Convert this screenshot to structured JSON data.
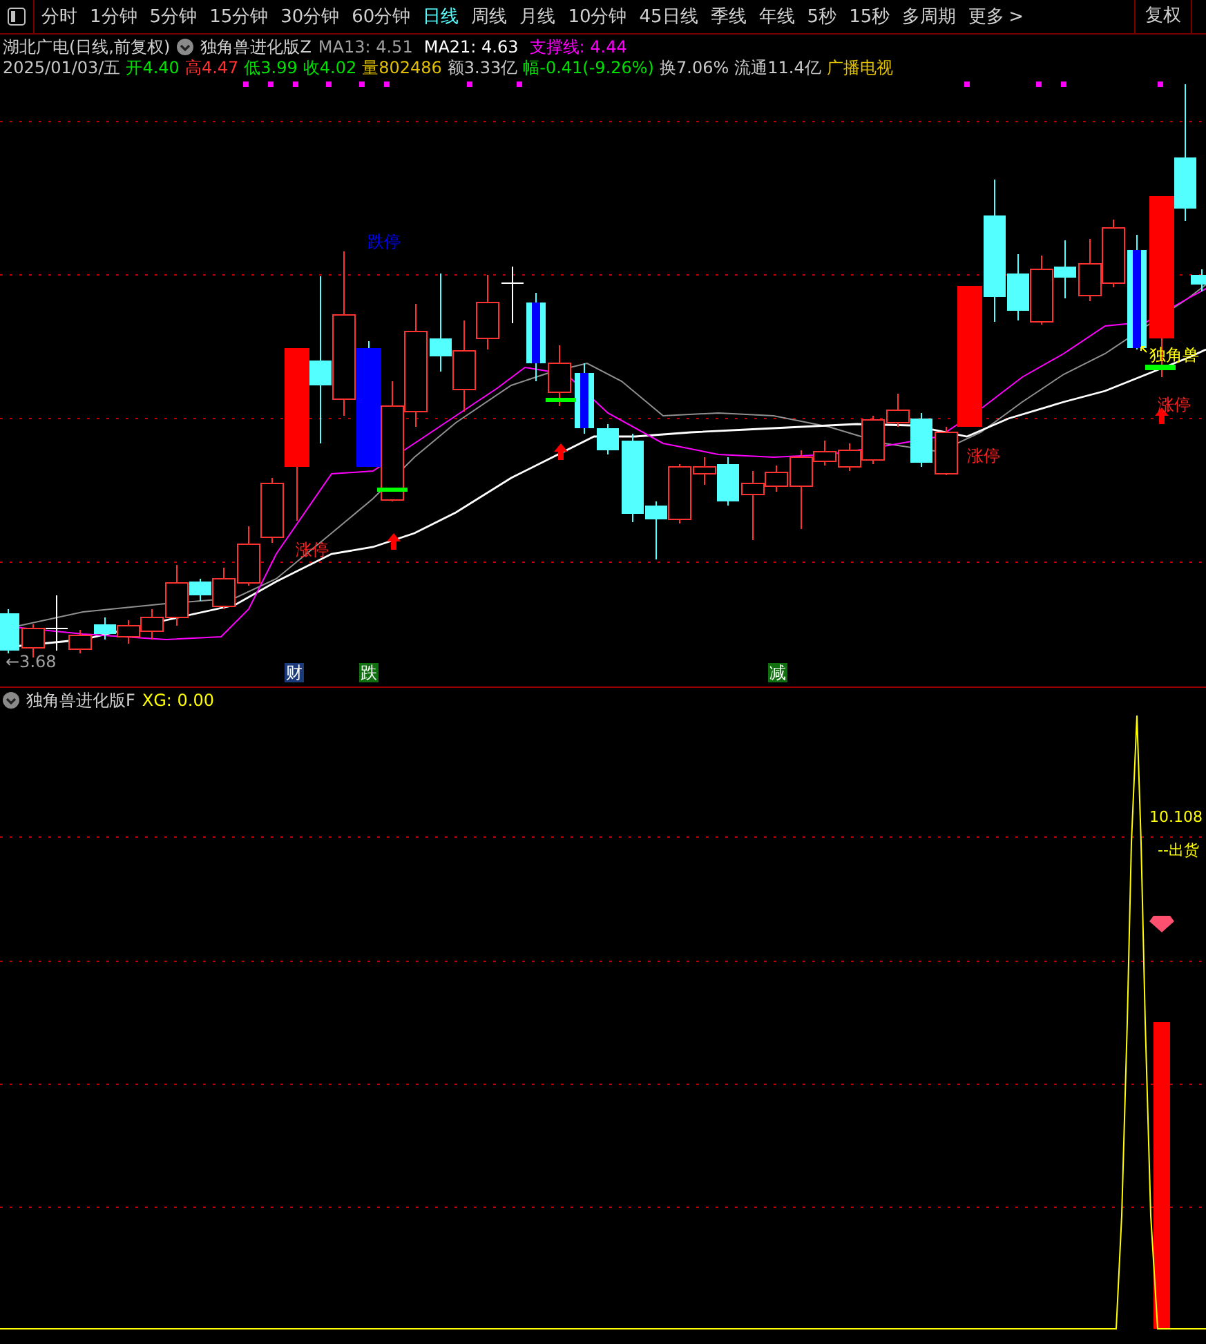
{
  "toolbar": {
    "items": [
      {
        "label": "分时",
        "selected": false
      },
      {
        "label": "1分钟",
        "selected": false
      },
      {
        "label": "5分钟",
        "selected": false
      },
      {
        "label": "15分钟",
        "selected": false
      },
      {
        "label": "30分钟",
        "selected": false
      },
      {
        "label": "60分钟",
        "selected": false
      },
      {
        "label": "日线",
        "selected": true
      },
      {
        "label": "周线",
        "selected": false
      },
      {
        "label": "月线",
        "selected": false
      },
      {
        "label": "10分钟",
        "selected": false
      },
      {
        "label": "45日线",
        "selected": false
      },
      {
        "label": "季线",
        "selected": false
      },
      {
        "label": "年线",
        "selected": false
      },
      {
        "label": "5秒",
        "selected": false
      },
      {
        "label": "15秒",
        "selected": false
      },
      {
        "label": "多周期",
        "selected": false
      },
      {
        "label": "更多",
        "selected": false
      }
    ],
    "more_caret": ">",
    "right_buttons": [
      "复权"
    ]
  },
  "header": {
    "stock": "湖北广电(日线,前复权)",
    "indicator": "独角兽进化版Z",
    "values": [
      {
        "text": "MA13: 4.51",
        "color": "#a0a0a0"
      },
      {
        "text": "MA21: 4.63",
        "color": "#ffffff"
      },
      {
        "text": "支撑线: 4.44",
        "color": "#ff00ff"
      }
    ]
  },
  "quote_line": [
    {
      "text": "2025/01/03/五",
      "color": "#c8c8c8"
    },
    {
      "text": "开4.40",
      "color": "#00e000"
    },
    {
      "text": "高4.47",
      "color": "#ff3232"
    },
    {
      "text": "低3.99",
      "color": "#00e000"
    },
    {
      "text": "收4.02",
      "color": "#00e000"
    },
    {
      "text": "量802486",
      "color": "#e0c000"
    },
    {
      "text": "额3.33亿",
      "color": "#c8c8c8"
    },
    {
      "text": "幅-0.41(-9.26%)",
      "color": "#00e000"
    },
    {
      "text": "换7.06%",
      "color": "#c8c8c8"
    },
    {
      "text": "流通11.4亿",
      "color": "#c8c8c8"
    },
    {
      "text": "广播电视",
      "color": "#e0c000"
    }
  ],
  "chart_labels": [
    {
      "text": "跌停",
      "color": "#0000ff"
    },
    {
      "text": "涨停",
      "color": "#ff2020"
    },
    {
      "text": "涨停",
      "color": "#ff2020"
    },
    {
      "text": "涨停",
      "color": "#ff2020"
    },
    {
      "text": "←3.68",
      "color": "#a0a0a0"
    },
    {
      "text": "独角兽",
      "color": "#ffff00"
    }
  ],
  "event_markers": [
    {
      "text": "财",
      "color": "#1a3a7a"
    },
    {
      "text": "跌",
      "color": "#107010"
    },
    {
      "text": "减",
      "color": "#107010"
    }
  ],
  "sub_panel": {
    "indicator": "独角兽进化版F",
    "value": "XG: 0.00",
    "labels": [
      "10.108",
      "--出货"
    ]
  }
}
